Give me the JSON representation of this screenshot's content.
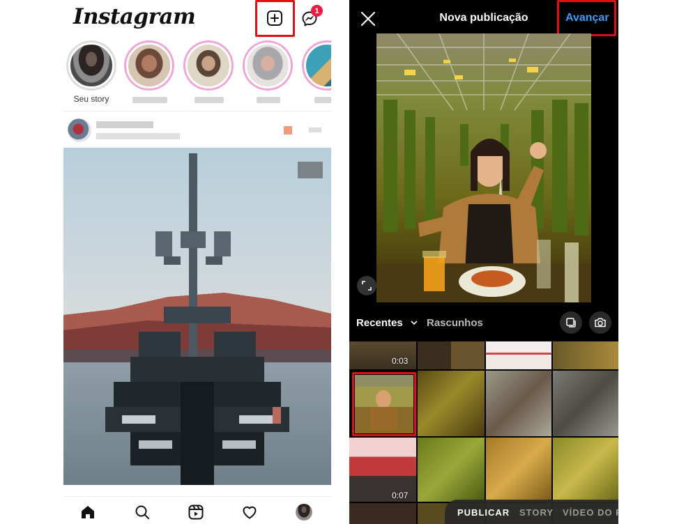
{
  "feed": {
    "logo_text": "Instagram",
    "messenger_badge": "1",
    "own_story_label": "Seu story",
    "nav": [
      "home-icon",
      "search-icon",
      "reels-icon",
      "heart-icon",
      "profile-avatar"
    ]
  },
  "new_post": {
    "title": "Nova publicação",
    "next_label": "Avançar",
    "tab_recent": "Recentes",
    "tab_drafts": "Rascunhos",
    "durations": [
      "0:03",
      "0:07"
    ],
    "modes": [
      "PUBLICAR",
      "STORY",
      "VÍDEO DO R"
    ]
  },
  "colors": {
    "highlight": "#e01010",
    "link_blue": "#3d9bf3",
    "badge_red": "#ed1b3f",
    "story_ring": "#f0a5d5"
  }
}
